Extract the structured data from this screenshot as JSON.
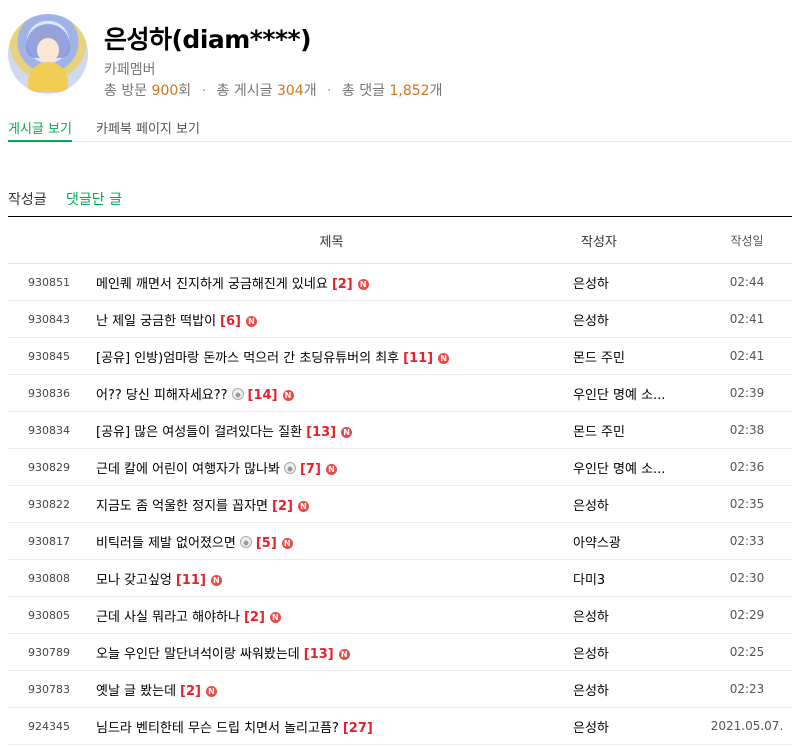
{
  "profile": {
    "nickname": "은성하(diam****)",
    "role": "카페멤버",
    "stats": {
      "visits_label": "총 방문",
      "visits": "900",
      "visits_unit": "회",
      "posts_label": "총 게시글",
      "posts": "304",
      "posts_unit": "개",
      "comments_label": "총 댓글",
      "comments": "1,852",
      "comments_unit": "개"
    }
  },
  "tabs": [
    {
      "label": "게시글 보기",
      "active": true
    },
    {
      "label": "카페북 페이지 보기",
      "active": false
    }
  ],
  "subtabs": [
    {
      "label": "작성글"
    },
    {
      "label": "댓글단 글"
    }
  ],
  "table": {
    "headers": {
      "title": "제목",
      "author": "작성자",
      "date": "작성일"
    },
    "rows": [
      {
        "id": "930851",
        "title": "메인퀘 깨면서 진지하게 궁금해진게 있네요",
        "comments": "[2]",
        "img": false,
        "new": true,
        "author": "은성하",
        "date": "02:44"
      },
      {
        "id": "930843",
        "title": "난 제일 궁금한 떡밥이",
        "comments": "[6]",
        "img": false,
        "new": true,
        "author": "은성하",
        "date": "02:41"
      },
      {
        "id": "930845",
        "title": "[공유] 인방)엄마랑 돈까스 먹으러 간 초딩유튜버의 최후",
        "comments": "[11]",
        "img": false,
        "new": true,
        "author": "몬드 주민",
        "date": "02:41"
      },
      {
        "id": "930836",
        "title": "어?? 당신 피해자세요??",
        "comments": "[14]",
        "img": true,
        "new": true,
        "author": "우인단 명예 소...",
        "date": "02:39"
      },
      {
        "id": "930834",
        "title": "[공유] 많은 여성들이 걸려있다는 질환",
        "comments": "[13]",
        "img": false,
        "new": true,
        "author": "몬드 주민",
        "date": "02:38"
      },
      {
        "id": "930829",
        "title": "근데 칼에 어린이 여행자가 많나봐",
        "comments": "[7]",
        "img": true,
        "new": true,
        "author": "우인단 명예 소...",
        "date": "02:36"
      },
      {
        "id": "930822",
        "title": "지금도 좀 억울한 정지를 꼽자면",
        "comments": "[2]",
        "img": false,
        "new": true,
        "author": "은성하",
        "date": "02:35"
      },
      {
        "id": "930817",
        "title": "비틱러들 제발 없어졌으면",
        "comments": "[5]",
        "img": true,
        "new": true,
        "author": "아약스광",
        "date": "02:33"
      },
      {
        "id": "930808",
        "title": "모나 갖고싶엉",
        "comments": "[11]",
        "img": false,
        "new": true,
        "author": "다미3",
        "date": "02:30"
      },
      {
        "id": "930805",
        "title": "근데 사실 뭐라고 해야하나",
        "comments": "[2]",
        "img": false,
        "new": true,
        "author": "은성하",
        "date": "02:29"
      },
      {
        "id": "930789",
        "title": "오늘 우인단 말단녀석이랑 싸워봤는데",
        "comments": "[13]",
        "img": false,
        "new": true,
        "author": "은성하",
        "date": "02:25"
      },
      {
        "id": "930783",
        "title": "옛날 글 봤는데",
        "comments": "[2]",
        "img": false,
        "new": true,
        "author": "은성하",
        "date": "02:23"
      },
      {
        "id": "924345",
        "title": "님드라 벤티한테 무슨 드립 치면서 놀리고픔?",
        "comments": "[27]",
        "img": false,
        "new": false,
        "author": "은성하",
        "date": "2021.05.07."
      }
    ]
  },
  "icons": {
    "new_badge": "N",
    "image_icon": "image-icon"
  },
  "colors": {
    "accent_green": "#03a94d",
    "stat_orange": "#d1731a",
    "comment_red": "#e3222a",
    "new_badge_red": "#e84a45"
  }
}
